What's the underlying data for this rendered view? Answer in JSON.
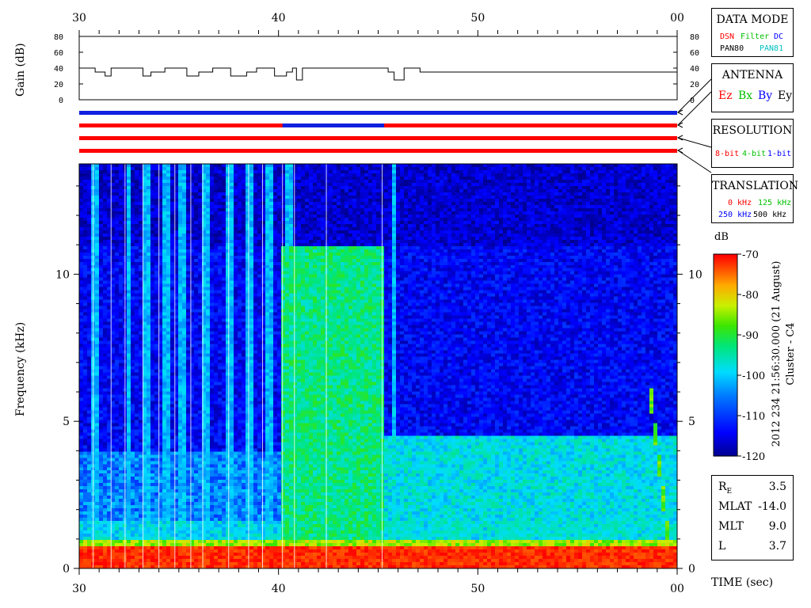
{
  "time_axis": {
    "ticks": [
      "30",
      "40",
      "50",
      "00"
    ],
    "label": "TIME (sec)"
  },
  "gain_panel": {
    "ylabel": "Gain (dB)",
    "ticks": [
      "0",
      "20",
      "40",
      "60",
      "80"
    ],
    "ylim": [
      0,
      80
    ]
  },
  "spectrogram": {
    "ylabel": "Frequency (kHz)",
    "ticks": [
      "0",
      "5",
      "10"
    ],
    "ylim_khz": [
      0,
      13.75
    ],
    "xlim_sec": [
      30,
      60
    ]
  },
  "data_mode": {
    "title": "DATA MODE",
    "dsn": "DSN",
    "filter": "Filter",
    "dc": "DC",
    "pan80": "PAN80",
    "pan81": "PAN81"
  },
  "antenna": {
    "title": "ANTENNA",
    "ez": "Ez",
    "bx": "Bx",
    "by": "By",
    "ey": "Ey"
  },
  "resolution": {
    "title": "RESOLUTION",
    "bit8": "8-bit",
    "bit4": "4-bit",
    "bit1": "1-bit"
  },
  "translation": {
    "title": "TRANSLATION",
    "k0": "0 kHz",
    "k125": "125 kHz",
    "k250": "250 kHz",
    "k500": "500 kHz"
  },
  "colorbar": {
    "unit": "dB",
    "ticks": [
      "-70",
      "-80",
      "-90",
      "-100",
      "-110",
      "-120"
    ],
    "range": [
      -120,
      -70
    ]
  },
  "caption": {
    "line1": "2012 234 21:56:30.000 (21 August)",
    "line2": "Cluster - C4"
  },
  "orbit": {
    "re_label": "R",
    "re_sub": "E",
    "re_value": "3.5",
    "mlat_label": "MLAT",
    "mlat_value": "-14.0",
    "mlt_label": "MLT",
    "mlt_value": "9.0",
    "l_label": "L",
    "l_value": "3.7"
  },
  "colors": {
    "red": "#ff0000",
    "green": "#00c000",
    "blue": "#0000ff",
    "cyan": "#00c0c0",
    "band_blue": "#1020e0"
  },
  "chart_data": [
    {
      "type": "line",
      "panel": "gain",
      "ylabel": "Gain (dB)",
      "xlim": [
        30,
        60
      ],
      "ylim": [
        0,
        80
      ],
      "x": [
        30,
        30.5,
        30.8,
        31.3,
        31.6,
        32.7,
        33.2,
        33.6,
        34.3,
        34.9,
        35.4,
        36.0,
        36.7,
        37.2,
        37.6,
        38.4,
        38.9,
        39.4,
        39.8,
        40.4,
        40.7,
        40.9,
        41.2,
        45.1,
        45.5,
        45.8,
        46.3,
        47.1,
        60
      ],
      "y": [
        40,
        40,
        35,
        30,
        40,
        40,
        30,
        35,
        40,
        40,
        30,
        35,
        40,
        40,
        30,
        35,
        40,
        40,
        30,
        35,
        40,
        25,
        40,
        40,
        35,
        25,
        40,
        35,
        35
      ]
    },
    {
      "type": "heatmap",
      "panel": "spectrogram",
      "xlabel": "TIME (sec)",
      "ylabel": "Frequency (kHz)",
      "xlim": [
        30,
        60
      ],
      "ylim": [
        0,
        13.75
      ],
      "zlim": [
        -120,
        -70
      ],
      "zunit": "dB"
    }
  ]
}
